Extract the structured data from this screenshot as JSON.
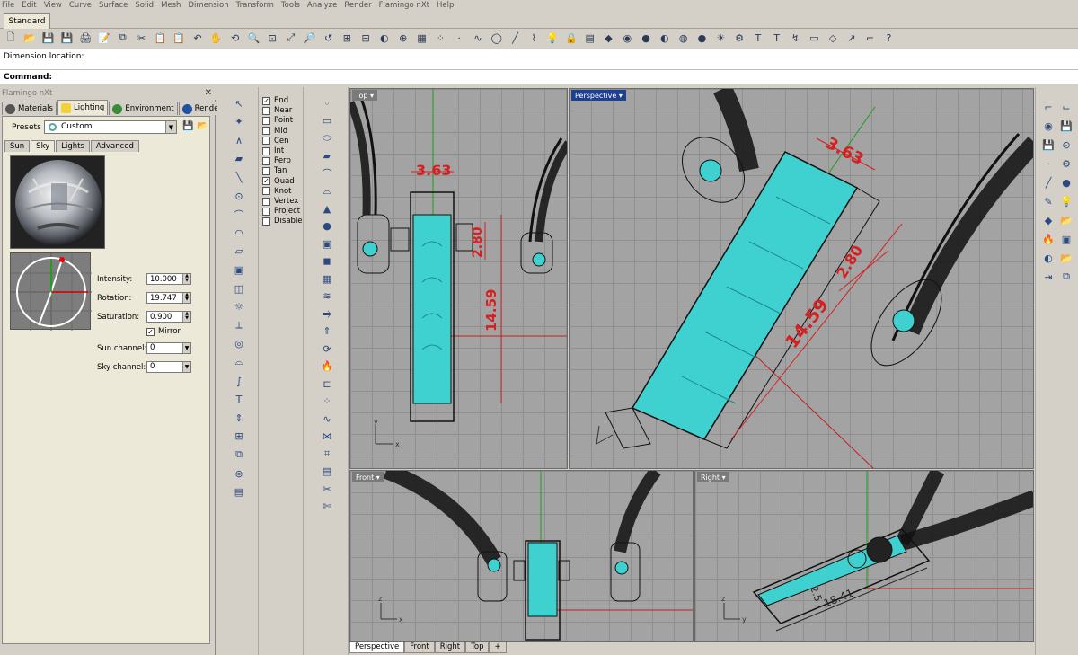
{
  "menu": [
    "File",
    "Edit",
    "View",
    "Curve",
    "Surface",
    "Solid",
    "Mesh",
    "Dimension",
    "Transform",
    "Tools",
    "Analyze",
    "Render",
    "Flamingo nXt",
    "Help"
  ],
  "toolbar_tab": "Standard",
  "toolbar_icons": [
    "new-icon",
    "open-icon",
    "save-icon",
    "save-as-icon",
    "print-icon",
    "properties-icon",
    "copy-icon",
    "cut-icon",
    "paste-icon",
    "clipboard-icon",
    "undo-icon",
    "pan-icon",
    "rotate-view-icon",
    "zoom-icon",
    "zoom-window-icon",
    "zoom-extents-icon",
    "zoom-selected-icon",
    "undo-view-icon",
    "four-viewports-icon",
    "cplane-icon",
    "set-view-icon",
    "object-snap-icon",
    "grid-icon",
    "select-points-icon",
    "point-icon",
    "curve-icon",
    "circle-icon",
    "line-icon",
    "polyline-icon",
    "light-icon",
    "lock-icon",
    "layer-icon",
    "material-icon",
    "render-icon",
    "shade-icon",
    "ghost-icon",
    "xray-icon",
    "sphere-icon",
    "sun-icon",
    "gear-icon",
    "text-icon",
    "text-tag-icon",
    "curve-drag-icon",
    "rectangle-icon",
    "shape-icon",
    "arrow-icon",
    "dim-icon",
    "help-icon"
  ],
  "command": {
    "history": "Dimension location:",
    "prompt": "Command:"
  },
  "flamingo": {
    "title": "Flamingo nXt",
    "tabs": [
      "Materials",
      "Lighting",
      "Environment",
      "Render"
    ],
    "active_tab": "Lighting",
    "presets_label": "Presets",
    "presets_value": "Custom",
    "sub_tabs": [
      "Sun",
      "Sky",
      "Lights",
      "Advanced"
    ],
    "active_sub_tab": "Sky",
    "params": [
      {
        "label": "Intensity:",
        "value": "10.000"
      },
      {
        "label": "Rotation:",
        "value": "19.747"
      },
      {
        "label": "Saturation:",
        "value": "0.900"
      }
    ],
    "mirror_label": "Mirror",
    "mirror_checked": true,
    "sun_channel_label": "Sun channel:",
    "sun_channel_value": "0",
    "sky_channel_label": "Sky channel:",
    "sky_channel_value": "0"
  },
  "osnaps": [
    {
      "label": "End",
      "checked": true
    },
    {
      "label": "Near",
      "checked": false
    },
    {
      "label": "Point",
      "checked": false
    },
    {
      "label": "Mid",
      "checked": false
    },
    {
      "label": "Cen",
      "checked": false
    },
    {
      "label": "Int",
      "checked": false
    },
    {
      "label": "Perp",
      "checked": false
    },
    {
      "label": "Tan",
      "checked": false
    },
    {
      "label": "Quad",
      "checked": true
    },
    {
      "label": "Knot",
      "checked": false
    },
    {
      "label": "Vertex",
      "checked": false
    },
    {
      "label": "Project",
      "checked": false
    },
    {
      "label": "Disable",
      "checked": false
    }
  ],
  "viewports": {
    "top": {
      "label": "Top",
      "dims": {
        "width": "3.63",
        "side": "2.80",
        "length": "14.59"
      }
    },
    "perspective": {
      "label": "Perspective",
      "dims": {
        "width": "3.63",
        "side": "2.80",
        "length": "14.59"
      }
    },
    "front": {
      "label": "Front"
    },
    "right": {
      "label": "Right",
      "dims": {
        "length": "18.41",
        "small": "2.5"
      }
    }
  },
  "viewport_tabs": [
    "Perspective",
    "Front",
    "Right",
    "Top"
  ],
  "axis": {
    "x": "x",
    "y": "y",
    "z": "z"
  },
  "colors": {
    "cyan": "#3fd0d0",
    "dim_red": "#d42020",
    "active_vp": "#1f3f8f",
    "grid": "#a3a3a3"
  }
}
